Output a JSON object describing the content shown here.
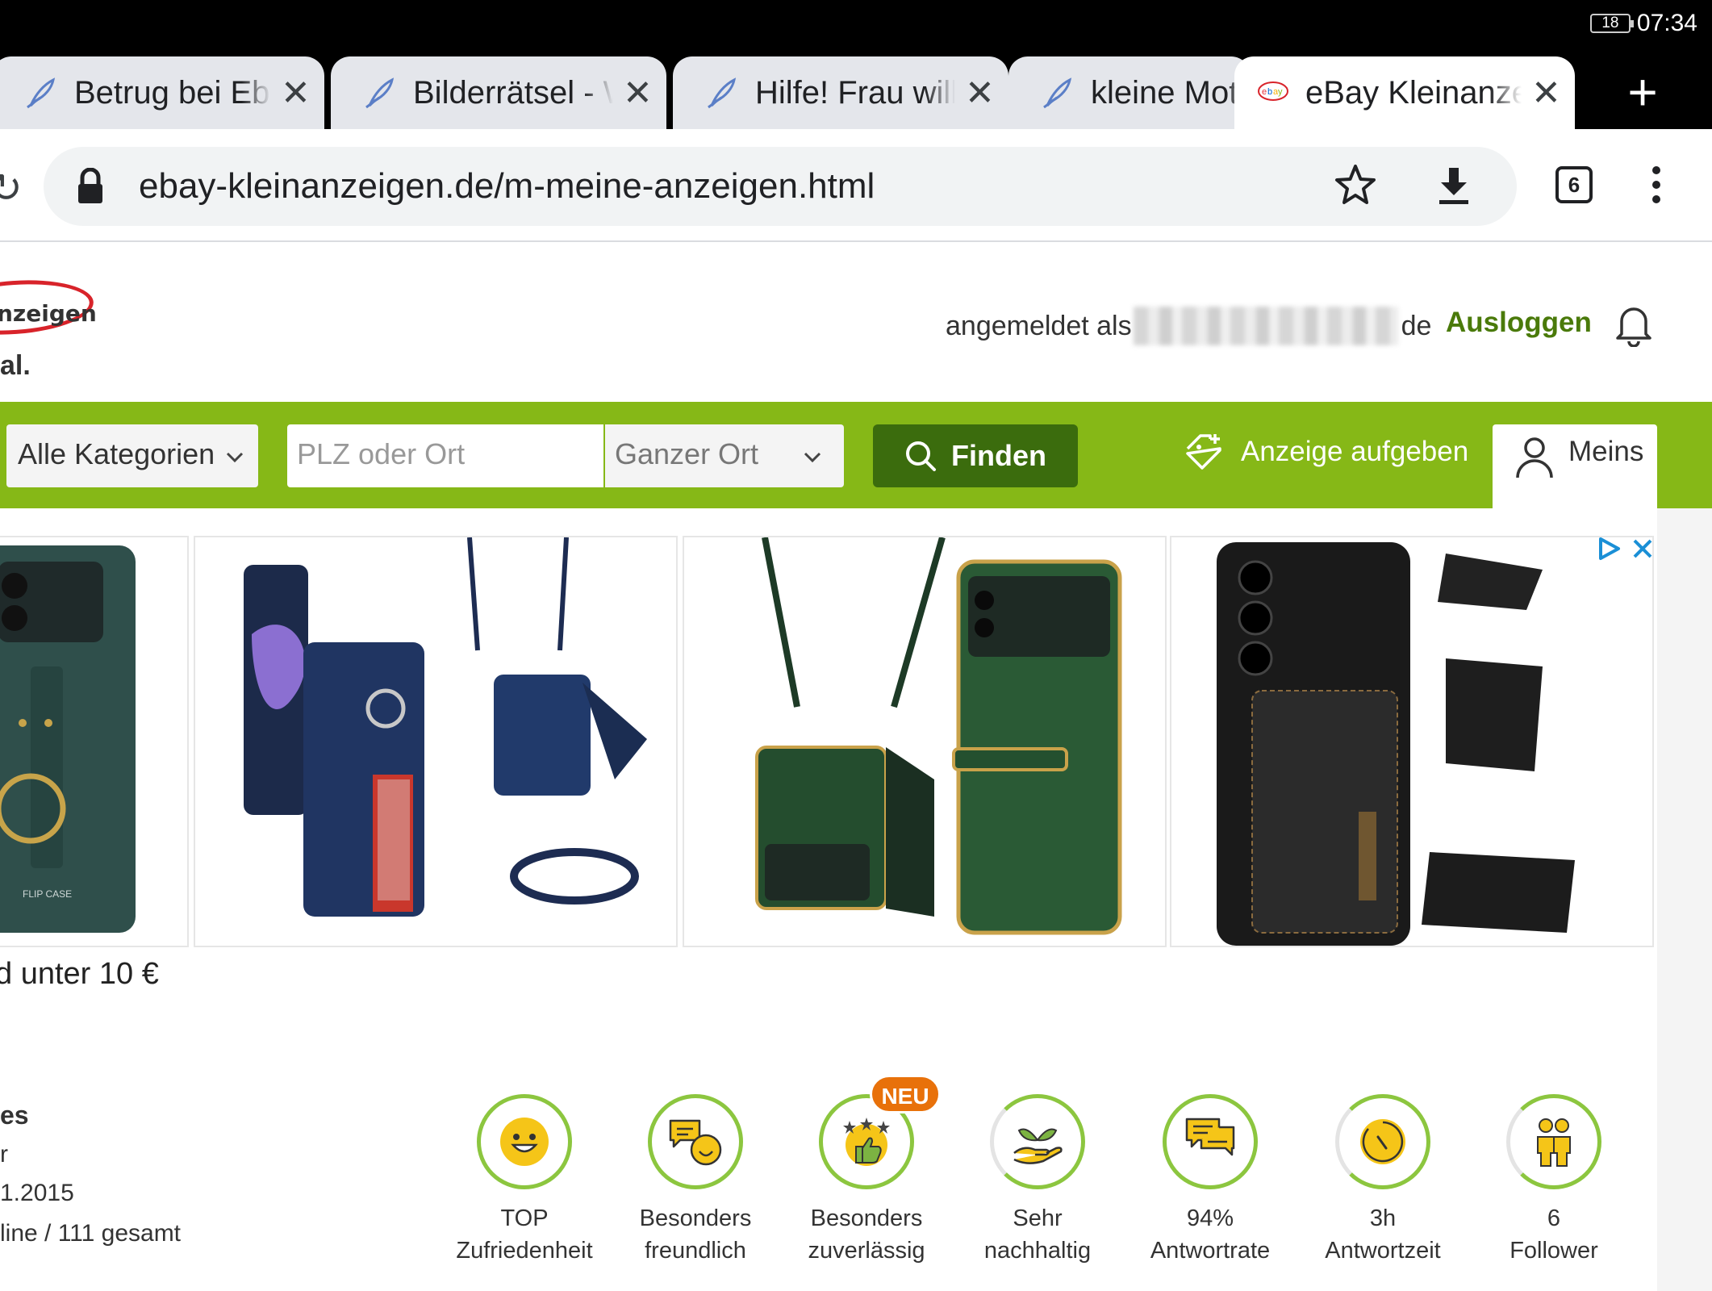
{
  "status": {
    "battery": "18",
    "time": "07:34"
  },
  "tabs": [
    {
      "title": "Betrug bei Ebay",
      "active": false
    },
    {
      "title": "Bilderrätsel - W",
      "active": false
    },
    {
      "title": "Hilfe! Frau will",
      "active": false
    },
    {
      "title": "kleine Moto",
      "active": false
    },
    {
      "title": "eBay Kleinanzeigen",
      "active": true
    }
  ],
  "browser": {
    "url": "ebay-kleinanzeigen.de/m-meine-anzeigen.html",
    "tab_count": "6"
  },
  "site": {
    "logo_text": "nzeigen",
    "logo_sub": "al.",
    "logged_in_prefix": "angemeldet als",
    "logged_in_suffix": "de",
    "logout": "Ausloggen"
  },
  "search": {
    "category": "Alle Kategorien",
    "location_placeholder": "PLZ oder Ort",
    "radius": "Ganzer Ort",
    "find": "Finden",
    "post_ad": "Anzeige aufgeben",
    "my": "Meins"
  },
  "ad_text": "d unter 10 €",
  "profile": {
    "line1": "es",
    "line2": "r",
    "line3": "1.2015",
    "line4": "line / 111 gesamt"
  },
  "badges": [
    {
      "line1": "TOP",
      "line2": "Zufriedenheit",
      "icon": "smiley-icon"
    },
    {
      "line1": "Besonders",
      "line2": "freundlich",
      "icon": "chat-smiley-icon"
    },
    {
      "line1": "Besonders",
      "line2": "zuverlässig",
      "icon": "thumbs-up-stars-icon"
    },
    {
      "line1": "Sehr",
      "line2": "nachhaltig",
      "icon": "plant-hand-icon"
    },
    {
      "line1": "94%",
      "line2": "Antwortrate",
      "icon": "messages-icon"
    },
    {
      "line1": "3h",
      "line2": "Antwortzeit",
      "icon": "clock-icon"
    },
    {
      "line1": "6",
      "line2": "Follower",
      "icon": "people-icon"
    }
  ],
  "neu_label": "NEU",
  "colors": {
    "brand_green": "#86b817",
    "dark_green": "#3b6c0d",
    "badge_green": "#8cc63f",
    "badge_yellow": "#f5c518",
    "neu_orange": "#e8710a"
  }
}
